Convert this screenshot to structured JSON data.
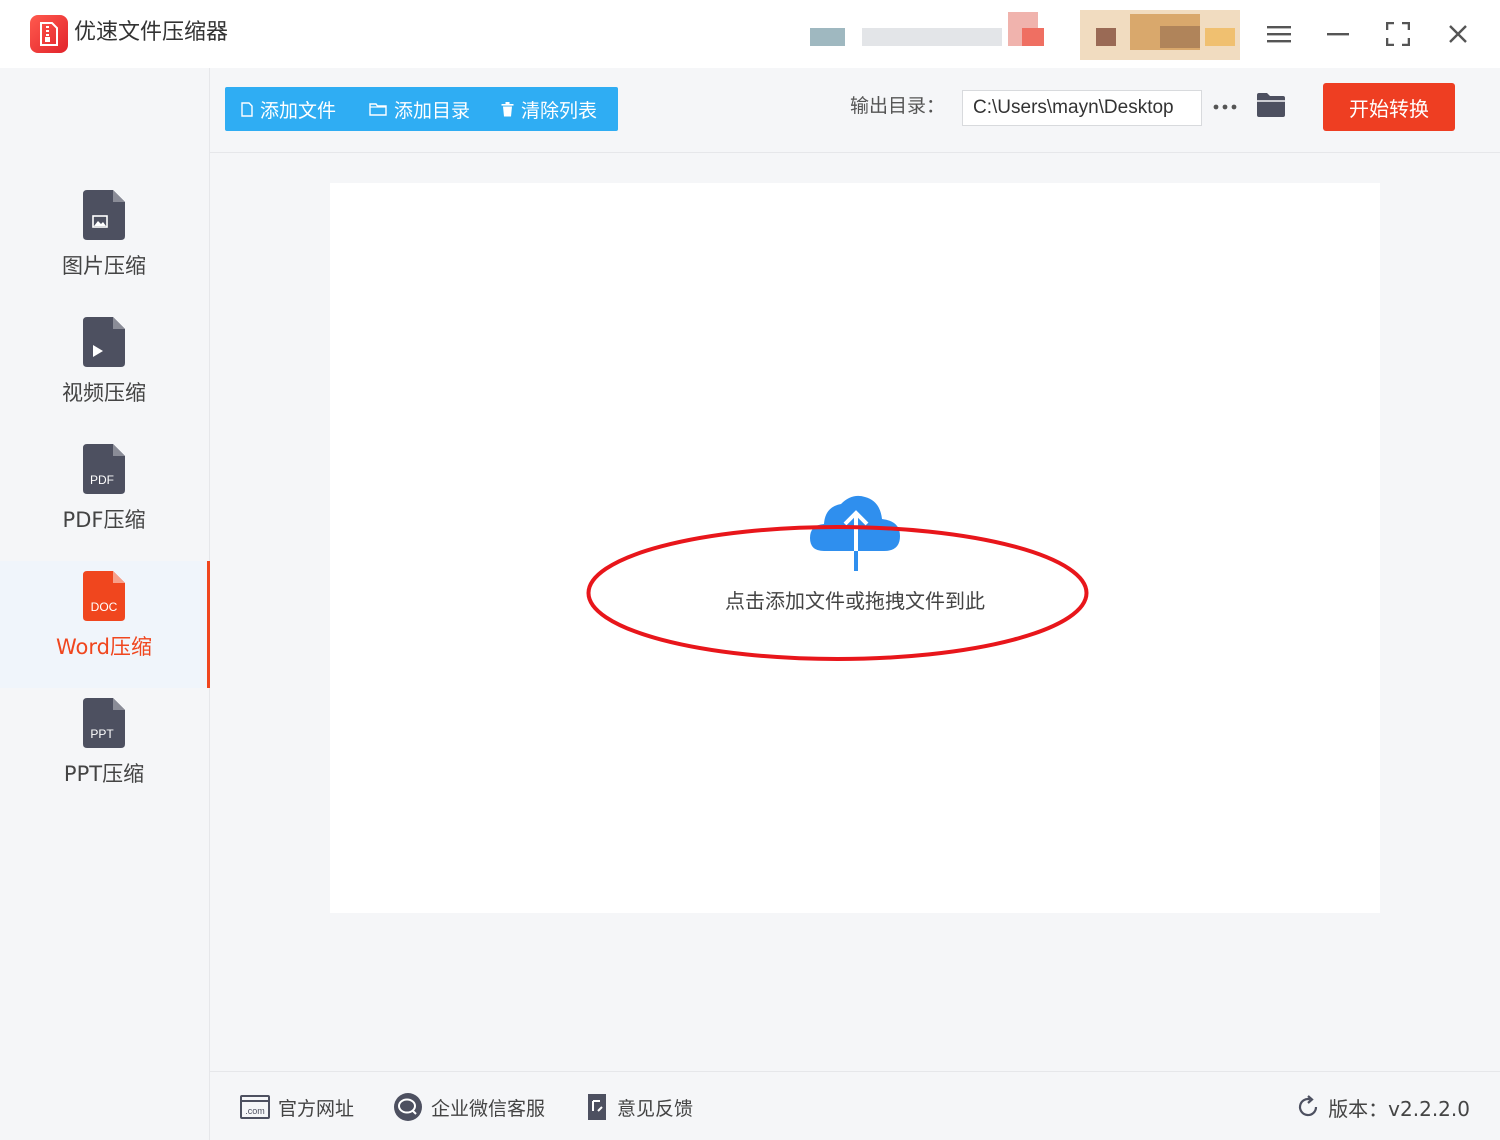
{
  "app": {
    "title": "优速文件压缩器"
  },
  "sidebar": {
    "items": [
      {
        "label": "图片压缩",
        "icon": "image-file-icon",
        "badge": ""
      },
      {
        "label": "视频压缩",
        "icon": "video-file-icon",
        "badge": ""
      },
      {
        "label": "PDF压缩",
        "icon": "pdf-file-icon",
        "badge": "PDF"
      },
      {
        "label": "Word压缩",
        "icon": "doc-file-icon",
        "badge": "DOC",
        "active": true
      },
      {
        "label": "PPT压缩",
        "icon": "ppt-file-icon",
        "badge": "PPT"
      }
    ]
  },
  "toolbar": {
    "add_file": "添加文件",
    "add_dir": "添加目录",
    "clear_list": "清除列表",
    "output_label": "输出目录：",
    "output_path": "C:\\Users\\mayn\\Desktop",
    "start": "开始转换"
  },
  "main": {
    "drop_text": "点击添加文件或拖拽文件到此"
  },
  "footer": {
    "website": "官方网址",
    "wechat_support": "企业微信客服",
    "feedback": "意见反馈",
    "version": "版本：v2.2.2.0"
  },
  "colors": {
    "accent": "#f0461e",
    "toolbar_blue": "#2fadf3",
    "start_button": "#ee3e22",
    "icon_gray": "#4d5060",
    "cloud_blue": "#2f8fee",
    "annotation_red": "#e8161b"
  }
}
